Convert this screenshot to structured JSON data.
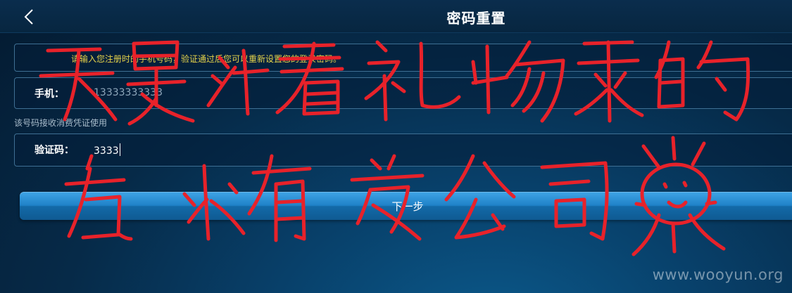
{
  "header": {
    "title": "密码重置",
    "back_icon": "chevron-left-icon"
  },
  "notice": {
    "text": "请输入您注册时的手机号码，验证通过后您可以重新设置您的登录密码。"
  },
  "phone": {
    "label": "手机：",
    "value": "13333333333"
  },
  "hint": {
    "text": "该号码接收消费凭证使用"
  },
  "code": {
    "label": "验证码：",
    "value": "3333"
  },
  "next_button": {
    "label": "下一步"
  },
  "watermark": {
    "text": "www.wooyun.org"
  },
  "colors": {
    "notice_text": "#e6d24a",
    "button": "#1f82c8",
    "scribble": "#e8222a",
    "background": "#062a48"
  }
}
